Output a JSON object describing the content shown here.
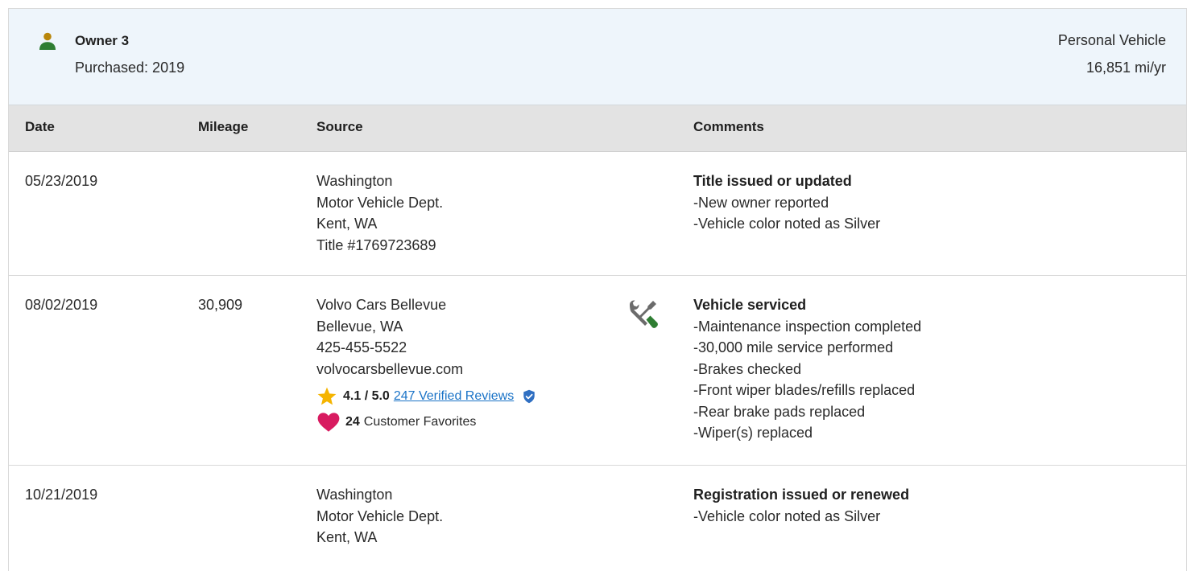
{
  "owner": {
    "name": "Owner 3",
    "purchased": "Purchased: 2019",
    "usage_type": "Personal Vehicle",
    "miles_per_year": "16,851 mi/yr",
    "icon": "person-icon",
    "icon_color": "#2e7d32"
  },
  "table": {
    "headers": {
      "date": "Date",
      "mileage": "Mileage",
      "source": "Source",
      "comments": "Comments"
    },
    "rows": [
      {
        "date": "05/23/2019",
        "mileage": "",
        "source": [
          "Washington",
          "Motor Vehicle Dept.",
          "Kent, WA",
          "Title #1769723689"
        ],
        "comment_title": "Title issued or updated",
        "comment_items": [
          "New owner reported",
          "Vehicle color noted as Silver"
        ]
      },
      {
        "date": "08/02/2019",
        "mileage": "30,909",
        "source": [
          "Volvo Cars Bellevue",
          "Bellevue, WA",
          "425-455-5522",
          "volvocarsbellevue.com"
        ],
        "rating": {
          "value": "4.1 / 5.0",
          "reviews_link": "247 Verified Reviews",
          "star_icon": "star-icon",
          "verified_icon": "verified-shield-icon"
        },
        "favorites": {
          "count": "24",
          "label": "Customer Favorites",
          "icon": "heart-icon"
        },
        "service_icon": "wrench-screwdriver-icon",
        "comment_title": "Vehicle serviced",
        "comment_items": [
          "Maintenance inspection completed",
          "30,000 mile service performed",
          "Brakes checked",
          "Front wiper blades/refills replaced",
          "Rear brake pads replaced",
          "Wiper(s) replaced"
        ]
      },
      {
        "date": "10/21/2019",
        "mileage": "",
        "source": [
          "Washington",
          "Motor Vehicle Dept.",
          "Kent, WA"
        ],
        "comment_title": "Registration issued or renewed",
        "comment_items": [
          "Vehicle color noted as Silver"
        ]
      }
    ]
  },
  "colors": {
    "header_bg": "#eef5fb",
    "table_head_bg": "#e3e3e3",
    "link": "#1a73c7",
    "star": "#f5b400",
    "heart": "#d81b60",
    "verified": "#2f6fc2",
    "service_green": "#2e7d32",
    "service_gray": "#6b6b6b"
  }
}
